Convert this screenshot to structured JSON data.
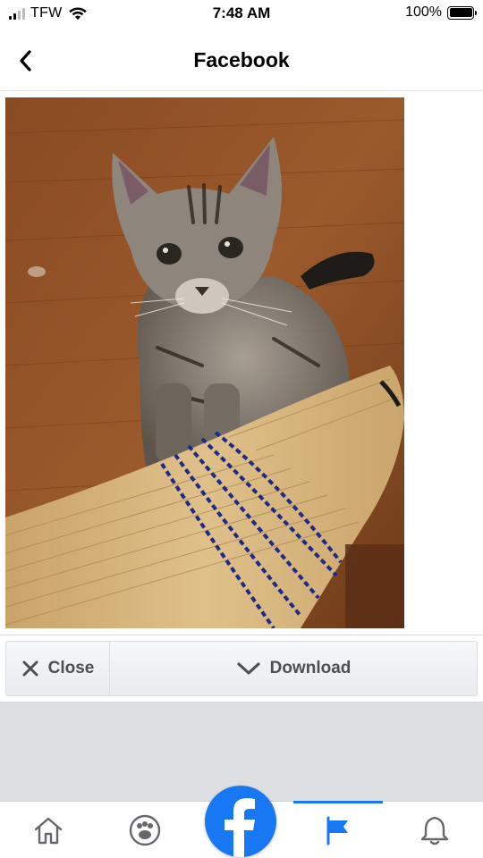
{
  "status_bar": {
    "carrier": "TFW",
    "time": "7:48 AM",
    "battery_percent": "100%",
    "signal_bars": 2,
    "battery_level": 1.0
  },
  "header": {
    "title": "Facebook",
    "back_icon": "chevron-left-icon"
  },
  "photo": {
    "icon": "photo-image"
  },
  "actions": {
    "close_label": "Close",
    "close_icon": "x-icon",
    "download_label": "Download",
    "download_icon": "chevron-down-icon"
  },
  "tab_bar": {
    "items": [
      {
        "icon": "home-icon",
        "active": false
      },
      {
        "icon": "groups-icon",
        "active": false
      },
      {
        "icon": "facebook-logo",
        "active": false
      },
      {
        "icon": "flag-icon",
        "active": true
      },
      {
        "icon": "bell-icon",
        "active": false
      }
    ]
  },
  "colors": {
    "brand": "#1877f2",
    "action_text": "#4b4f56",
    "background_gray": "#dddfe2"
  }
}
